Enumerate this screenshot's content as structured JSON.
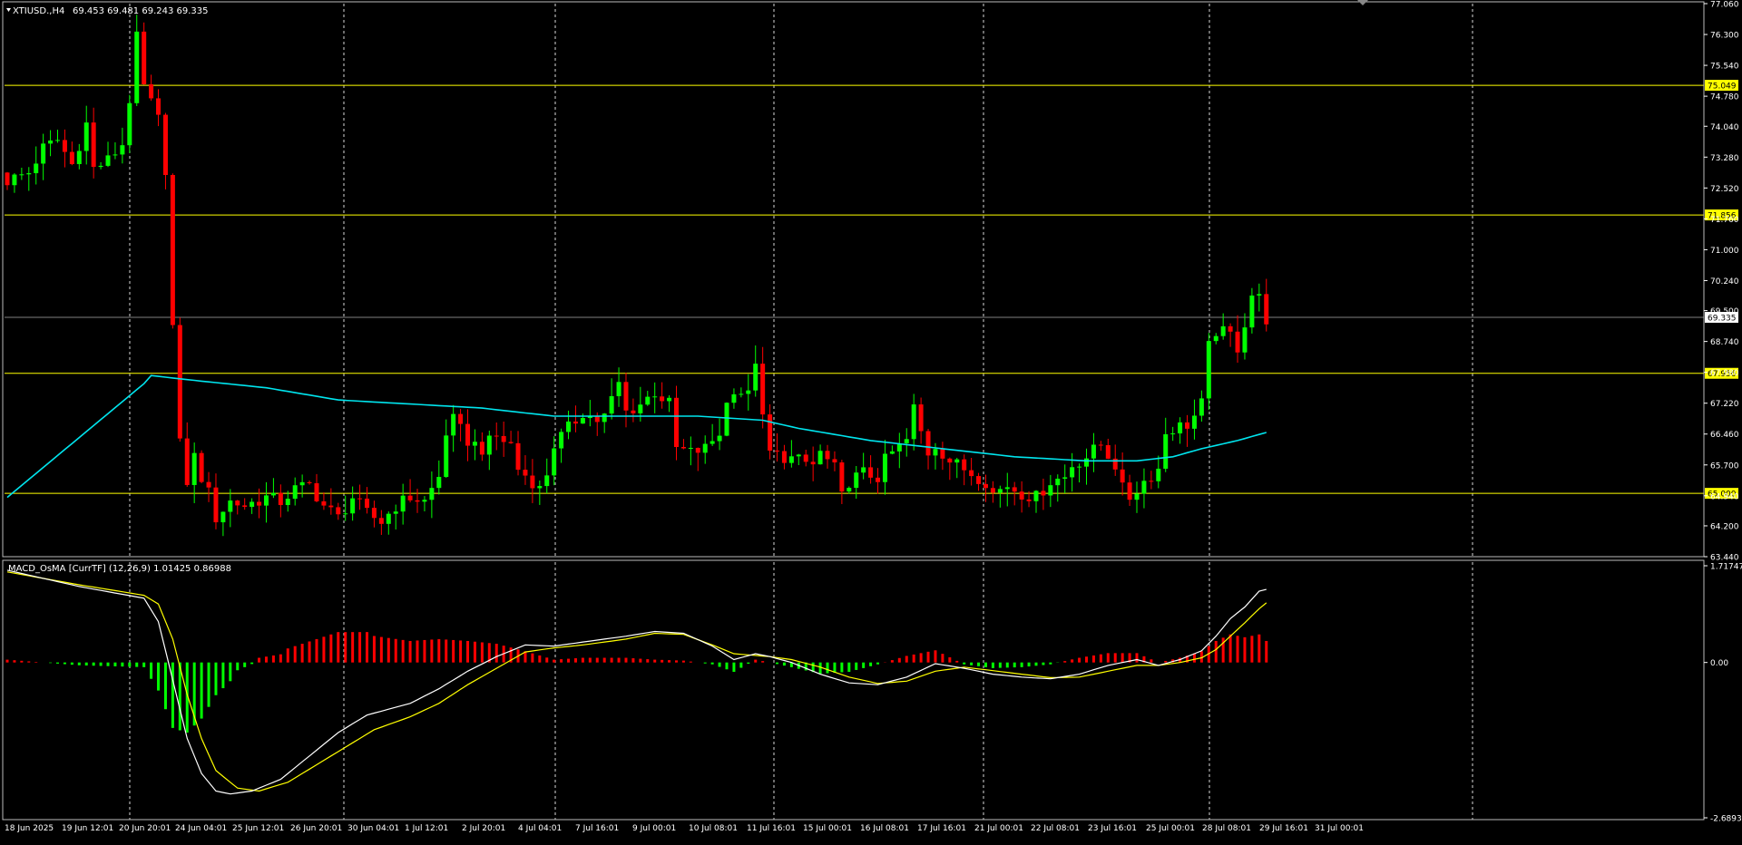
{
  "chart_data": [
    {
      "type": "candlestick",
      "symbol_header": "XTIUSD.,H4",
      "ohlc_header": "69.453 69.481 69.243 69.335",
      "ylim": [
        63.44,
        77.06
      ],
      "y_ticks": [
        "77.060",
        "76.300",
        "75.540",
        "74.780",
        "74.040",
        "73.280",
        "72.520",
        "71.760",
        "71.000",
        "70.240",
        "69.500",
        "68.740",
        "67.980",
        "67.220",
        "66.460",
        "65.700",
        "64.940",
        "64.200",
        "63.440"
      ],
      "horizontal_levels": [
        {
          "value": 75.049,
          "label": "75.049"
        },
        {
          "value": 71.856,
          "label": "71.856"
        },
        {
          "value": 67.956,
          "label": "67.956"
        },
        {
          "value": 65.0,
          "label": "65.000"
        }
      ],
      "current_price": {
        "value": 69.335,
        "label": "69.335"
      },
      "bull_color": "#00ff00",
      "bear_color": "#ff0000",
      "ma_color": "#00e5ee",
      "level_color": "#ffff00",
      "x_labels": [
        "18 Jun 2025",
        "19 Jun 12:01",
        "20 Jun 20:01",
        "24 Jun 04:01",
        "25 Jun 12:01",
        "26 Jun 20:01",
        "30 Jun 04:01",
        "1 Jul 12:01",
        "2 Jul 20:01",
        "4 Jul 04:01",
        "7 Jul 16:01",
        "9 Jul 00:01",
        "10 Jul 08:01",
        "11 Jul 16:01",
        "15 Jul 00:01",
        "16 Jul 08:01",
        "17 Jul 16:01",
        "21 Jul 00:01",
        "22 Jul 08:01",
        "23 Jul 16:01",
        "25 Jul 00:01",
        "28 Jul 08:01",
        "29 Jul 16:01",
        "31 Jul 00:01"
      ],
      "vertical_grid_at": [
        "20 Jun 20:01",
        "4 Jul 04:01",
        "11 Jul 16:01",
        "17 Jul 16:01",
        "25 Jul 00:01",
        "31 Jul 00:01"
      ],
      "close_path": [
        [
          0,
          72.7
        ],
        [
          3,
          72.9
        ],
        [
          5,
          73.5
        ],
        [
          7,
          73.7
        ],
        [
          9,
          73.1
        ],
        [
          11,
          74.1
        ],
        [
          12,
          73.0
        ],
        [
          14,
          73.2
        ],
        [
          16,
          73.6
        ],
        [
          17,
          74.7
        ],
        [
          18,
          76.2
        ],
        [
          19,
          75.0
        ],
        [
          20,
          74.6
        ],
        [
          21,
          74.2
        ],
        [
          22,
          73.0
        ],
        [
          23,
          69.1
        ],
        [
          24,
          66.2
        ],
        [
          25,
          65.3
        ],
        [
          26,
          65.9
        ],
        [
          27,
          65.4
        ],
        [
          28,
          65.0
        ],
        [
          29,
          64.4
        ],
        [
          31,
          64.8
        ],
        [
          33,
          64.7
        ],
        [
          36,
          64.9
        ],
        [
          38,
          64.8
        ],
        [
          40,
          65.1
        ],
        [
          42,
          65.2
        ],
        [
          44,
          64.7
        ],
        [
          46,
          64.4
        ],
        [
          48,
          64.9
        ],
        [
          50,
          64.5
        ],
        [
          52,
          64.3
        ],
        [
          54,
          64.7
        ],
        [
          56,
          64.9
        ],
        [
          58,
          64.8
        ],
        [
          60,
          65.4
        ],
        [
          61,
          66.5
        ],
        [
          62,
          66.8
        ],
        [
          64,
          66.3
        ],
        [
          66,
          66.1
        ],
        [
          68,
          66.4
        ],
        [
          70,
          66.2
        ],
        [
          71,
          65.6
        ],
        [
          73,
          65.3
        ],
        [
          74,
          65.1
        ],
        [
          75,
          65.5
        ],
        [
          76,
          66.2
        ],
        [
          78,
          66.6
        ],
        [
          80,
          67.0
        ],
        [
          82,
          66.8
        ],
        [
          83,
          66.9
        ],
        [
          84,
          67.3
        ],
        [
          85,
          67.7
        ],
        [
          86,
          67.0
        ],
        [
          88,
          67.2
        ],
        [
          90,
          67.5
        ],
        [
          92,
          67.2
        ],
        [
          93,
          66.1
        ],
        [
          95,
          66.0
        ],
        [
          97,
          66.1
        ],
        [
          99,
          66.5
        ],
        [
          100,
          67.2
        ],
        [
          101,
          67.6
        ],
        [
          103,
          67.4
        ],
        [
          104,
          68.3
        ],
        [
          105,
          66.8
        ],
        [
          106,
          66.0
        ],
        [
          108,
          65.9
        ],
        [
          110,
          65.8
        ],
        [
          112,
          65.7
        ],
        [
          113,
          66.0
        ],
        [
          114,
          65.8
        ],
        [
          115,
          65.6
        ],
        [
          116,
          64.9
        ],
        [
          117,
          65.3
        ],
        [
          119,
          65.5
        ],
        [
          121,
          65.4
        ],
        [
          122,
          65.8
        ],
        [
          123,
          66.0
        ],
        [
          125,
          66.3
        ],
        [
          126,
          67.1
        ],
        [
          127,
          66.5
        ],
        [
          128,
          66.0
        ],
        [
          129,
          66.2
        ],
        [
          131,
          65.8
        ],
        [
          132,
          65.7
        ],
        [
          134,
          65.5
        ],
        [
          136,
          65.3
        ],
        [
          137,
          65.0
        ],
        [
          139,
          65.2
        ],
        [
          141,
          65.0
        ],
        [
          143,
          64.9
        ],
        [
          145,
          65.3
        ],
        [
          147,
          65.4
        ],
        [
          148,
          65.7
        ],
        [
          150,
          65.9
        ],
        [
          152,
          66.2
        ],
        [
          154,
          65.7
        ],
        [
          155,
          65.1
        ],
        [
          156,
          64.9
        ],
        [
          158,
          65.3
        ],
        [
          160,
          65.6
        ],
        [
          161,
          66.5
        ],
        [
          162,
          66.6
        ],
        [
          164,
          66.7
        ],
        [
          165,
          66.9
        ],
        [
          166,
          67.2
        ],
        [
          167,
          68.6
        ],
        [
          168,
          69.0
        ],
        [
          170,
          68.9
        ],
        [
          171,
          68.6
        ],
        [
          172,
          69.2
        ],
        [
          173,
          69.9
        ],
        [
          174,
          69.8
        ],
        [
          175,
          69.3
        ]
      ],
      "ma_path": [
        [
          0,
          64.9
        ],
        [
          19,
          67.7
        ],
        [
          20,
          67.9
        ],
        [
          25,
          67.8
        ],
        [
          36,
          67.6
        ],
        [
          46,
          67.3
        ],
        [
          56,
          67.2
        ],
        [
          66,
          67.1
        ],
        [
          76,
          66.9
        ],
        [
          86,
          66.9
        ],
        [
          96,
          66.9
        ],
        [
          105,
          66.8
        ],
        [
          110,
          66.6
        ],
        [
          120,
          66.3
        ],
        [
          130,
          66.1
        ],
        [
          140,
          65.9
        ],
        [
          150,
          65.8
        ],
        [
          157,
          65.8
        ],
        [
          162,
          65.9
        ],
        [
          166,
          66.1
        ],
        [
          171,
          66.3
        ],
        [
          175,
          66.5
        ]
      ]
    },
    {
      "type": "bar",
      "title": "MACD_OsMA [CurrTF] (12,26,9) 1.01425 0.86988",
      "ylim": [
        -2.68938,
        1.71747
      ],
      "y_ticks": [
        "1.71747",
        "0.00",
        "-2.68938"
      ],
      "macd_color": "#ffffff",
      "signal_color": "#ffff00",
      "hist_pos_color": "#ff0000",
      "hist_neg_color": "#00ff00",
      "macd_path": [
        [
          0,
          1.58
        ],
        [
          10,
          1.3
        ],
        [
          19,
          1.1
        ],
        [
          21,
          0.7
        ],
        [
          23,
          -0.3
        ],
        [
          25,
          -1.3
        ],
        [
          27,
          -1.9
        ],
        [
          29,
          -2.2
        ],
        [
          31,
          -2.25
        ],
        [
          34,
          -2.2
        ],
        [
          38,
          -2.0
        ],
        [
          42,
          -1.6
        ],
        [
          46,
          -1.2
        ],
        [
          50,
          -0.9
        ],
        [
          56,
          -0.7
        ],
        [
          60,
          -0.45
        ],
        [
          64,
          -0.15
        ],
        [
          68,
          0.1
        ],
        [
          72,
          0.3
        ],
        [
          76,
          0.28
        ],
        [
          80,
          0.35
        ],
        [
          86,
          0.45
        ],
        [
          90,
          0.53
        ],
        [
          94,
          0.5
        ],
        [
          98,
          0.28
        ],
        [
          101,
          0.05
        ],
        [
          104,
          0.15
        ],
        [
          106,
          0.1
        ],
        [
          109,
          0.0
        ],
        [
          113,
          -0.2
        ],
        [
          117,
          -0.35
        ],
        [
          121,
          -0.38
        ],
        [
          125,
          -0.25
        ],
        [
          129,
          -0.02
        ],
        [
          133,
          -0.1
        ],
        [
          137,
          -0.2
        ],
        [
          141,
          -0.25
        ],
        [
          145,
          -0.28
        ],
        [
          149,
          -0.2
        ],
        [
          153,
          -0.05
        ],
        [
          157,
          0.05
        ],
        [
          160,
          -0.05
        ],
        [
          163,
          0.05
        ],
        [
          166,
          0.2
        ],
        [
          168,
          0.45
        ],
        [
          170,
          0.75
        ],
        [
          172,
          0.95
        ],
        [
          174,
          1.22
        ],
        [
          175,
          1.25
        ]
      ],
      "signal_path": [
        [
          0,
          1.55
        ],
        [
          10,
          1.33
        ],
        [
          19,
          1.15
        ],
        [
          21,
          1.0
        ],
        [
          23,
          0.4
        ],
        [
          25,
          -0.55
        ],
        [
          27,
          -1.3
        ],
        [
          29,
          -1.85
        ],
        [
          32,
          -2.15
        ],
        [
          35,
          -2.2
        ],
        [
          39,
          -2.05
        ],
        [
          43,
          -1.75
        ],
        [
          47,
          -1.45
        ],
        [
          51,
          -1.15
        ],
        [
          56,
          -0.93
        ],
        [
          60,
          -0.7
        ],
        [
          64,
          -0.38
        ],
        [
          68,
          -0.1
        ],
        [
          72,
          0.18
        ],
        [
          76,
          0.25
        ],
        [
          80,
          0.3
        ],
        [
          86,
          0.4
        ],
        [
          90,
          0.5
        ],
        [
          94,
          0.48
        ],
        [
          98,
          0.3
        ],
        [
          101,
          0.15
        ],
        [
          104,
          0.12
        ],
        [
          106,
          0.1
        ],
        [
          109,
          0.05
        ],
        [
          113,
          -0.08
        ],
        [
          117,
          -0.25
        ],
        [
          121,
          -0.36
        ],
        [
          125,
          -0.32
        ],
        [
          129,
          -0.15
        ],
        [
          133,
          -0.08
        ],
        [
          137,
          -0.14
        ],
        [
          141,
          -0.2
        ],
        [
          145,
          -0.26
        ],
        [
          149,
          -0.25
        ],
        [
          153,
          -0.15
        ],
        [
          157,
          -0.05
        ],
        [
          160,
          -0.05
        ],
        [
          163,
          0.0
        ],
        [
          166,
          0.08
        ],
        [
          168,
          0.22
        ],
        [
          170,
          0.45
        ],
        [
          172,
          0.68
        ],
        [
          174,
          0.92
        ],
        [
          175,
          1.02
        ]
      ]
    }
  ]
}
